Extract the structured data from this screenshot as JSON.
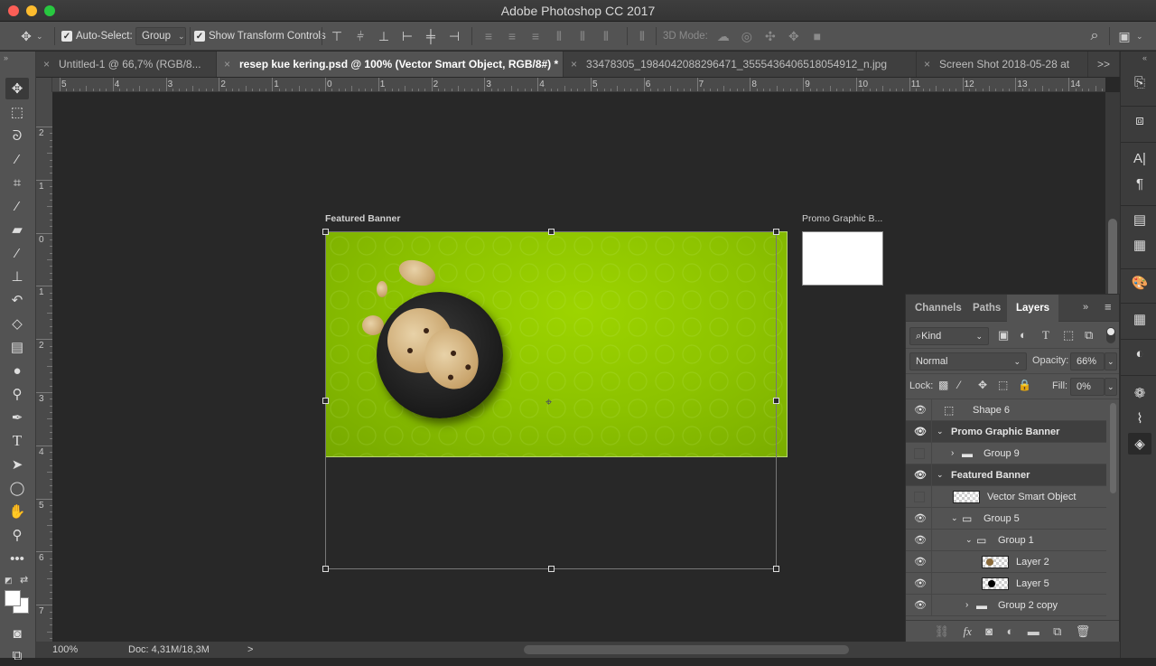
{
  "window": {
    "title": "Adobe Photoshop CC 2017"
  },
  "options_bar": {
    "move_tool_icon": "move-icon",
    "auto_select_label": "Auto-Select:",
    "auto_select_checked": true,
    "auto_select_value": "Group",
    "show_transform_label": "Show Transform Controls",
    "show_transform_checked": true,
    "three_d_mode_label": "3D Mode:",
    "align_icons": [
      "align-top-edges",
      "align-vertical-centers",
      "align-bottom-edges",
      "align-left-edges",
      "align-horizontal-centers",
      "align-right-edges"
    ],
    "distribute_icons": [
      "distribute-top",
      "distribute-vcenter",
      "distribute-bottom",
      "distribute-left",
      "distribute-hcenter",
      "distribute-right",
      "auto-align"
    ],
    "three_d_icons": [
      "orbit-3d",
      "roll-3d",
      "pan-3d",
      "slide-3d",
      "scale-3d"
    ]
  },
  "tabs": [
    {
      "label": "Untitled-1 @ 66,7% (RGB/8...",
      "active": false
    },
    {
      "label": "resep kue kering.psd @ 100% (Vector Smart Object, RGB/8#) *",
      "active": true
    },
    {
      "label": "33478305_1984042088296471_3555436406518054912_n.jpg",
      "active": false
    },
    {
      "label": "Screen Shot 2018-05-28 at",
      "active": false
    }
  ],
  "tabs_overflow": ">>",
  "ruler": {
    "horizontal": [
      "5",
      "4",
      "3",
      "2",
      "1",
      "0",
      "1",
      "2",
      "3",
      "4",
      "5",
      "6",
      "7",
      "8",
      "9",
      "10",
      "11",
      "12",
      "13",
      "14"
    ],
    "vertical": [
      "2",
      "1",
      "0",
      "1",
      "2",
      "3",
      "4",
      "5",
      "6",
      "7"
    ]
  },
  "canvas": {
    "artboards": [
      {
        "label": "Featured Banner",
        "color": "#8cc200"
      },
      {
        "label": "Promo Graphic B...",
        "color": "#ffffff"
      }
    ]
  },
  "status": {
    "zoom": "100%",
    "doc": "Doc: 4,31M/18,3M",
    "arrow": ">"
  },
  "layers_panel": {
    "tabs": [
      {
        "label": "Channels",
        "active": false
      },
      {
        "label": "Paths",
        "active": false
      },
      {
        "label": "Layers",
        "active": true
      }
    ],
    "filter_label": "Kind",
    "blend_mode": "Normal",
    "opacity_label": "Opacity:",
    "opacity_value": "66%",
    "lock_label": "Lock:",
    "fill_label": "Fill:",
    "fill_value": "0%",
    "layers": [
      {
        "name": "Shape 6",
        "visible": true,
        "type": "shape",
        "indent": 0,
        "group_header": false
      },
      {
        "name": "Promo Graphic Banner",
        "visible": true,
        "type": "artboard",
        "indent": 0,
        "expanded": true,
        "group_header": true
      },
      {
        "name": "Group 9",
        "visible": false,
        "type": "group",
        "indent": 1,
        "expanded": false,
        "group_header": false
      },
      {
        "name": "Featured Banner",
        "visible": true,
        "type": "artboard",
        "indent": 0,
        "expanded": true,
        "group_header": true
      },
      {
        "name": "Vector Smart Object",
        "visible": false,
        "type": "smart-object",
        "indent": 1,
        "group_header": false
      },
      {
        "name": "Group 5",
        "visible": true,
        "type": "group",
        "indent": 1,
        "expanded": true,
        "group_header": false
      },
      {
        "name": "Group 1",
        "visible": true,
        "type": "group",
        "indent": 2,
        "expanded": true,
        "group_header": false
      },
      {
        "name": "Layer 2",
        "visible": true,
        "type": "pixel",
        "indent": 3,
        "group_header": false
      },
      {
        "name": "Layer 5",
        "visible": true,
        "type": "pixel",
        "indent": 3,
        "group_header": false
      },
      {
        "name": "Group 2 copy",
        "visible": true,
        "type": "group",
        "indent": 2,
        "expanded": false,
        "group_header": false
      }
    ],
    "footer_icons": [
      "link-layers",
      "fx",
      "add-mask",
      "adjustment",
      "new-group",
      "new-layer",
      "delete"
    ]
  },
  "tools": [
    "move",
    "marquee",
    "lasso",
    "magic-wand",
    "crop",
    "eyedropper",
    "healing",
    "brush",
    "stamp",
    "history-brush",
    "eraser",
    "gradient",
    "blur",
    "dodge",
    "pen",
    "type",
    "path-select",
    "ellipse",
    "hand",
    "zoom",
    "more"
  ],
  "right_dock": [
    "history",
    "3d",
    "character",
    "paragraph",
    "properties",
    "notes",
    "swatches",
    "grid-libraries",
    "adjustments",
    "channels",
    "paths",
    "layers"
  ]
}
